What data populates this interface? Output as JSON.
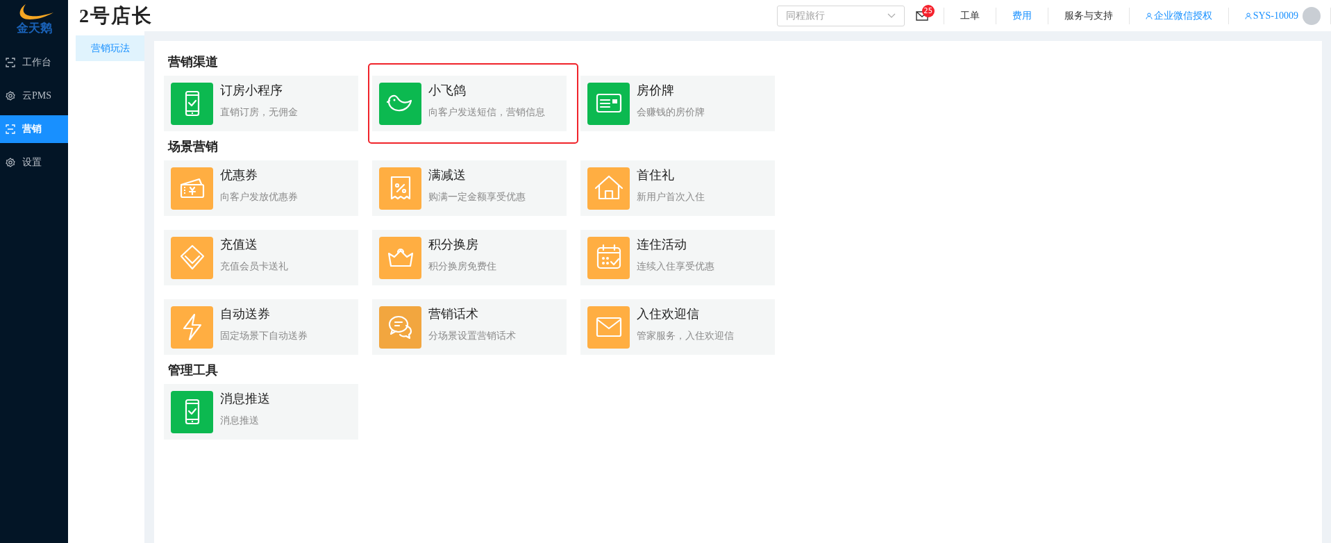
{
  "sidebar": {
    "logo_text": "金天鹅",
    "items": [
      {
        "label": "工作台",
        "kind": "frame",
        "selected": false
      },
      {
        "label": "云PMS",
        "kind": "gear",
        "selected": false
      },
      {
        "label": "营销",
        "kind": "frame",
        "selected": true
      },
      {
        "label": "设置",
        "kind": "gear",
        "selected": false
      }
    ]
  },
  "header": {
    "title": "2号店长",
    "channel_select": {
      "value": "同程旅行"
    },
    "messages": {
      "count": "25"
    },
    "links": [
      {
        "label": "工单",
        "kind": "plain"
      },
      {
        "label": "费用",
        "kind": "accent"
      },
      {
        "label": "服务与支持",
        "kind": "plain"
      },
      {
        "label": "企业微信授权",
        "kind": "user"
      },
      {
        "label": "SYS-10009",
        "kind": "user"
      }
    ]
  },
  "subnav": {
    "items": [
      {
        "label": "营销玩法",
        "selected": true
      }
    ]
  },
  "sections": [
    {
      "title": "营销渠道",
      "cards": [
        {
          "title": "订房小程序",
          "description": "直销订房，无佣金",
          "kind": "phone",
          "color": "#0cb950",
          "highlighted": false
        },
        {
          "title": "小飞鸽",
          "description": "向客户发送短信，营销信息",
          "kind": "bird",
          "color": "#0cb950",
          "highlighted": true
        },
        {
          "title": "房价牌",
          "description": "会赚钱的房价牌",
          "kind": "card",
          "color": "#0cb950",
          "highlighted": false
        }
      ]
    },
    {
      "title": "场景营销",
      "cards": [
        {
          "title": "优惠券",
          "description": "向客户发放优惠券",
          "kind": "coupon",
          "color": "#ffae42",
          "highlighted": false
        },
        {
          "title": "满减送",
          "description": "购满一定金额享受优惠",
          "kind": "percent",
          "color": "#ffae42",
          "highlighted": false
        },
        {
          "title": "首住礼",
          "description": "新用户首次入住",
          "kind": "house",
          "color": "#ffae42",
          "highlighted": false
        },
        {
          "title": "充值送",
          "description": "充值会员卡送礼",
          "kind": "diamond",
          "color": "#ffae42",
          "highlighted": false
        },
        {
          "title": "积分换房",
          "description": "积分换房免费住",
          "kind": "crown",
          "color": "#ffae42",
          "highlighted": false
        },
        {
          "title": "连住活动",
          "description": "连续入住享受优惠",
          "kind": "calendar",
          "color": "#ffae42",
          "highlighted": false
        },
        {
          "title": "自动送券",
          "description": "固定场景下自动送券",
          "kind": "bolt",
          "color": "#ffae42",
          "highlighted": false
        },
        {
          "title": "营销话术",
          "description": "分场景设置营销话术",
          "kind": "chat",
          "color": "#f2a63f",
          "highlighted": false
        },
        {
          "title": "入住欢迎信",
          "description": "管家服务，入住欢迎信",
          "kind": "envelope",
          "color": "#ffae42",
          "highlighted": false
        }
      ]
    },
    {
      "title": "管理工具",
      "cards": [
        {
          "title": "消息推送",
          "description": "消息推送",
          "kind": "phone",
          "color": "#0cb950",
          "highlighted": false
        }
      ]
    }
  ]
}
